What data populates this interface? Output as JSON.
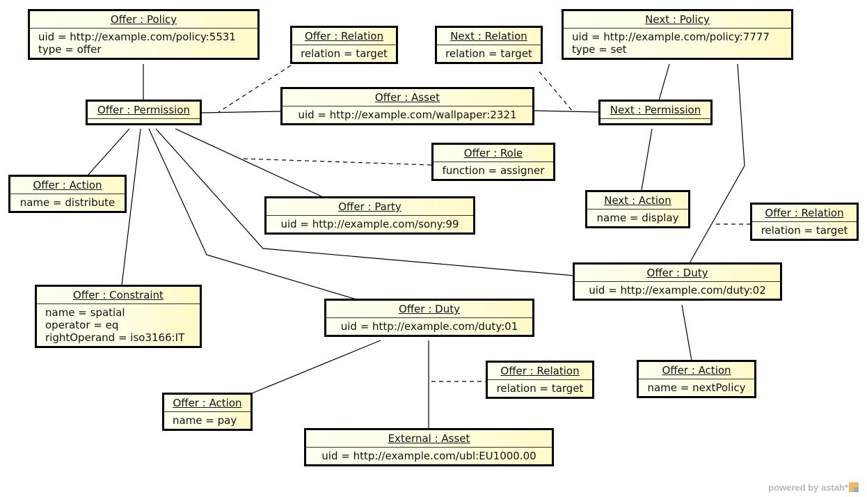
{
  "objects": {
    "offer_policy": {
      "title": "Offer : Policy",
      "attrs": [
        "uid = http://example.com/policy:5531",
        "type = offer"
      ]
    },
    "offer_relation_top": {
      "title": "Offer : Relation",
      "attrs": [
        "relation = target"
      ]
    },
    "next_relation": {
      "title": "Next : Relation",
      "attrs": [
        "relation = target"
      ]
    },
    "next_policy": {
      "title": "Next : Policy",
      "attrs": [
        "uid = http://example.com/policy:7777",
        "type = set"
      ]
    },
    "offer_permission": {
      "title": "Offer : Permission",
      "attrs": []
    },
    "offer_asset": {
      "title": "Offer : Asset",
      "attrs": [
        "uid = http://example.com/wallpaper:2321"
      ]
    },
    "next_permission": {
      "title": "Next : Permission",
      "attrs": []
    },
    "offer_role": {
      "title": "Offer : Role",
      "attrs": [
        "function = assigner"
      ]
    },
    "offer_action_distribute": {
      "title": "Offer : Action",
      "attrs": [
        "name = distribute"
      ]
    },
    "offer_party": {
      "title": "Offer : Party",
      "attrs": [
        "uid = http://example.com/sony:99"
      ]
    },
    "next_action": {
      "title": "Next : Action",
      "attrs": [
        "name = display"
      ]
    },
    "offer_relation_right": {
      "title": "Offer : Relation",
      "attrs": [
        "relation = target"
      ]
    },
    "offer_duty_02": {
      "title": "Offer : Duty",
      "attrs": [
        "uid = http://example.com/duty:02"
      ]
    },
    "offer_constraint": {
      "title": "Offer : Constraint",
      "attrs": [
        "name = spatial",
        "operator = eq",
        "rightOperand = iso3166:IT"
      ]
    },
    "offer_duty_01": {
      "title": "Offer : Duty",
      "attrs": [
        "uid = http://example.com/duty:01"
      ]
    },
    "offer_relation_bottom": {
      "title": "Offer : Relation",
      "attrs": [
        "relation = target"
      ]
    },
    "offer_action_next_policy": {
      "title": "Offer : Action",
      "attrs": [
        "name = nextPolicy"
      ]
    },
    "offer_action_pay": {
      "title": "Offer : Action",
      "attrs": [
        "name = pay"
      ]
    },
    "external_asset": {
      "title": "External : Asset",
      "attrs": [
        "uid = http://example.com/ubl:EU1000.00"
      ]
    }
  },
  "links": [
    {
      "from": "offer_policy",
      "to": "offer_permission",
      "style": "solid"
    },
    {
      "from": "offer_permission",
      "to": "offer_asset",
      "style": "solid"
    },
    {
      "from": "offer_asset",
      "to": "next_permission",
      "style": "solid"
    },
    {
      "from": "next_policy",
      "to": "next_permission",
      "style": "solid"
    },
    {
      "from": "next_permission",
      "to": "next_action",
      "style": "solid"
    },
    {
      "from": "next_policy",
      "to": "offer_duty_02",
      "style": "solid"
    },
    {
      "from": "offer_permission",
      "to": "offer_action_distribute",
      "style": "solid"
    },
    {
      "from": "offer_permission",
      "to": "offer_constraint",
      "style": "solid"
    },
    {
      "from": "offer_permission",
      "to": "offer_party",
      "style": "solid"
    },
    {
      "from": "offer_permission",
      "to": "offer_duty_01",
      "style": "solid"
    },
    {
      "from": "offer_permission",
      "to": "offer_duty_02",
      "style": "solid"
    },
    {
      "from": "offer_duty_01",
      "to": "offer_action_pay",
      "style": "solid"
    },
    {
      "from": "offer_duty_01",
      "to": "external_asset",
      "style": "solid"
    },
    {
      "from": "offer_duty_02",
      "to": "offer_action_next_policy",
      "style": "solid"
    },
    {
      "from": "offer_relation_top",
      "to": "offer_permission-asset",
      "style": "dashed"
    },
    {
      "from": "next_relation",
      "to": "offer_asset-next_permission",
      "style": "dashed"
    },
    {
      "from": "offer_role",
      "to": "offer_permission-party",
      "style": "dashed"
    },
    {
      "from": "offer_relation_right",
      "to": "next_policy-duty_02",
      "style": "dashed"
    },
    {
      "from": "offer_relation_bottom",
      "to": "duty_01-external_asset",
      "style": "dashed"
    }
  ],
  "footer": {
    "text": "powered by astah*"
  }
}
